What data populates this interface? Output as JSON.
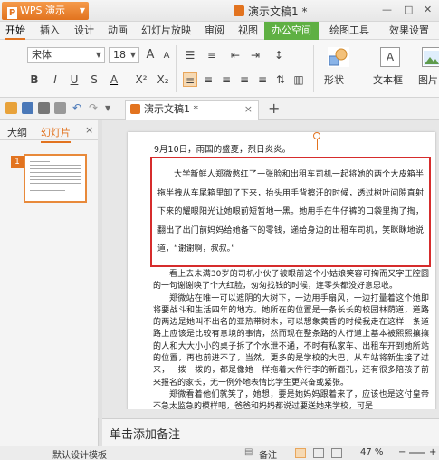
{
  "titlebar": {
    "app_button": "WPS 演示",
    "logo_letter": "P",
    "doc_title": "演示文稿1 *",
    "controls": [
      "—",
      "□",
      "✕"
    ]
  },
  "menubar": {
    "items": [
      "开始",
      "插入",
      "设计",
      "动画",
      "幻灯片放映",
      "审阅",
      "视图",
      "办公空间",
      "绘图工具",
      "效果设置"
    ],
    "active": "开始",
    "highlighted": "办公空间"
  },
  "ribbon": {
    "font_name": "宋体",
    "font_size": "18",
    "grow_font": "A",
    "shrink_font": "A",
    "bold": "B",
    "italic": "I",
    "underline": "U",
    "strikethrough": "S",
    "font_color": "A",
    "superscript": "X²",
    "subscript": "X₂",
    "shape_label": "形状",
    "textbox_label": "文本框",
    "picture_label": "图片",
    "accent_color": "#e2731f"
  },
  "quickbar": {
    "tab_label": "演示文稿1 *",
    "tab_close": "×",
    "add_tab": "+"
  },
  "leftpanel": {
    "tabs": [
      "大纲",
      "幻灯片"
    ],
    "active_tab": "幻灯片",
    "close": "×",
    "slide_number": "1"
  },
  "slide": {
    "date_line": "9月10日，雨国的盛夏，烈日炎炎。",
    "highlighted_paragraph": "大学新鲜人郑微憋红了一张脸和出租车司机一起将她的两个大皮箱半拖半拽从车尾箱里卸了下来，抬头用手背擦汗的时候，透过树叶间隙直射下来的耀眼阳光让她眼前短暂地一黑。她用手在牛仔裤的口袋里掏了掏，翻出了出门前妈妈给她备下的零钱，递给身边的出租车司机，笑眯眯地说道，“谢谢啊，叔叔。”",
    "paragraphs": [
      "看上去未满30岁的司机小伙子被眼前这个小姑娘笑容可掬而又字正腔圆的一句谢谢唤了个大红脸，匆匆找钱的时候，连零头都没好意思收。",
      "郑微站在唯一可以遮阴的大树下，一边用手扇风，一边打量着这个她即将要战斗和生活四年的地方。她所在的位置是一条长长的校园林荫道，道路的两边是她叫不出名的亚热带树木，可以想象黄昏的时候我走在这样一条道路上应该是比较有意境的事情，然而现在整条路的人行道上基本被熙熙攘攘的人和大大小小的桌子拆了个水泄不通，不时有私家车、出租车开到她所站的位置，再也前进不了，当然，更多的是学校的大巴，从车站将新生接了过来，一拨一拨的，都是像她一样拖着大件行李的新面孔，还有很多陪孩子前来报名的家长，无一例外地表情比学生更兴奋或紧张。",
      "郑微看着他们就笑了，她想，要是她妈妈跟着来了，应该也是这付皇帝不急太监急的模样吧，爸爸和妈妈都说过要送她来学校，可是"
    ]
  },
  "notes": {
    "placeholder": "单击添加备注"
  },
  "statusbar": {
    "template": "默认设计模板",
    "notes_toggle": "备注",
    "zoom": "47 %",
    "zoom_minus": "−",
    "zoom_plus": "+"
  }
}
